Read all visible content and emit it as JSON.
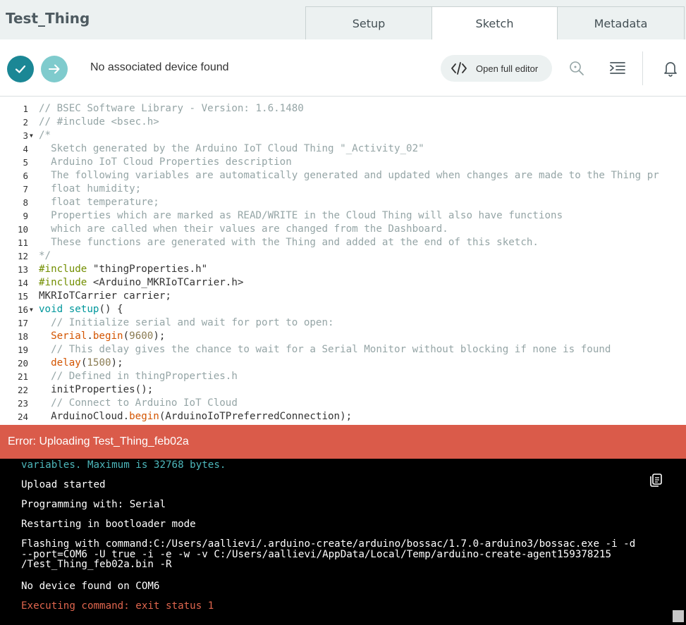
{
  "header": {
    "thing_title": "Test_Thing",
    "tabs": [
      {
        "label": "Setup"
      },
      {
        "label": "Sketch"
      },
      {
        "label": "Metadata"
      }
    ],
    "active_tab": "Sketch"
  },
  "toolbar": {
    "device_status": "No associated device found",
    "open_editor_label": "Open full editor",
    "icons": [
      "check-icon",
      "arrow-right-icon",
      "code-icon",
      "search-icon",
      "indent-icon",
      "bell-icon"
    ]
  },
  "editor": {
    "lines": [
      {
        "n": "1",
        "fold": "",
        "tokens": [
          [
            "c-comment",
            "// BSEC Software Library - Version: 1.6.1480"
          ]
        ]
      },
      {
        "n": "2",
        "fold": "",
        "tokens": [
          [
            "c-comment",
            "// #include <bsec.h>"
          ]
        ]
      },
      {
        "n": "3",
        "fold": "▼",
        "tokens": [
          [
            "c-comment",
            "/*"
          ]
        ]
      },
      {
        "n": "4",
        "fold": "",
        "tokens": [
          [
            "c-comment",
            "  Sketch generated by the Arduino IoT Cloud Thing \"_Activity_02\""
          ]
        ]
      },
      {
        "n": "5",
        "fold": "",
        "tokens": [
          [
            "c-comment",
            "  Arduino IoT Cloud Properties description"
          ]
        ]
      },
      {
        "n": "6",
        "fold": "",
        "tokens": [
          [
            "c-comment",
            "  The following variables are automatically generated and updated when changes are made to the Thing pr"
          ]
        ]
      },
      {
        "n": "7",
        "fold": "",
        "tokens": [
          [
            "c-comment",
            "  float humidity;"
          ]
        ]
      },
      {
        "n": "8",
        "fold": "",
        "tokens": [
          [
            "c-comment",
            "  float temperature;"
          ]
        ]
      },
      {
        "n": "9",
        "fold": "",
        "tokens": [
          [
            "c-comment",
            "  Properties which are marked as READ/WRITE in the Cloud Thing will also have functions"
          ]
        ]
      },
      {
        "n": "10",
        "fold": "",
        "tokens": [
          [
            "c-comment",
            "  which are called when their values are changed from the Dashboard."
          ]
        ]
      },
      {
        "n": "11",
        "fold": "",
        "tokens": [
          [
            "c-comment",
            "  These functions are generated with the Thing and added at the end of this sketch."
          ]
        ]
      },
      {
        "n": "12",
        "fold": "",
        "tokens": [
          [
            "c-comment",
            "*/"
          ]
        ]
      },
      {
        "n": "13",
        "fold": "",
        "tokens": [
          [
            "c-pp",
            "#include"
          ],
          [
            "",
            " \"thingProperties.h\""
          ]
        ]
      },
      {
        "n": "14",
        "fold": "",
        "tokens": [
          [
            "c-pp",
            "#include"
          ],
          [
            "",
            " <Arduino_MKRIoTCarrier.h>"
          ]
        ]
      },
      {
        "n": "15",
        "fold": "",
        "tokens": [
          [
            "",
            "MKRIoTCarrier carrier;"
          ]
        ]
      },
      {
        "n": "16",
        "fold": "▼",
        "tokens": [
          [
            "c-kw",
            "void"
          ],
          [
            "",
            " "
          ],
          [
            "c-kw",
            "setup"
          ],
          [
            "",
            "() {"
          ]
        ]
      },
      {
        "n": "17",
        "fold": "",
        "tokens": [
          [
            "c-comment",
            "  // Initialize serial and wait for port to open:"
          ]
        ]
      },
      {
        "n": "18",
        "fold": "",
        "tokens": [
          [
            "",
            "  "
          ],
          [
            "c-fn",
            "Serial"
          ],
          [
            "",
            "."
          ],
          [
            "c-fn",
            "begin"
          ],
          [
            "",
            "("
          ],
          [
            "c-num",
            "9600"
          ],
          [
            "",
            ");"
          ]
        ]
      },
      {
        "n": "19",
        "fold": "",
        "tokens": [
          [
            "c-comment",
            "  // This delay gives the chance to wait for a Serial Monitor without blocking if none is found"
          ]
        ]
      },
      {
        "n": "20",
        "fold": "",
        "tokens": [
          [
            "",
            "  "
          ],
          [
            "c-fn",
            "delay"
          ],
          [
            "",
            "("
          ],
          [
            "c-num",
            "1500"
          ],
          [
            "",
            ");"
          ]
        ]
      },
      {
        "n": "21",
        "fold": "",
        "tokens": [
          [
            "c-comment",
            "  // Defined in thingProperties.h"
          ]
        ]
      },
      {
        "n": "22",
        "fold": "",
        "tokens": [
          [
            "",
            "  initProperties();"
          ]
        ]
      },
      {
        "n": "23",
        "fold": "",
        "tokens": [
          [
            "c-comment",
            "  // Connect to Arduino IoT Cloud"
          ]
        ]
      },
      {
        "n": "24",
        "fold": "",
        "tokens": [
          [
            "",
            "  ArduinoCloud."
          ],
          [
            "c-fn",
            "begin"
          ],
          [
            "",
            "(ArduinoIoTPreferredConnection);"
          ]
        ]
      }
    ]
  },
  "error_banner": {
    "text": "Error: Uploading Test_Thing_feb02a"
  },
  "console": {
    "lines": [
      {
        "style": "console-green",
        "text": "variables. Maximum is 32768 bytes."
      },
      {
        "style": "",
        "text": "Upload started"
      },
      {
        "style": "",
        "text": "Programming with: Serial"
      },
      {
        "style": "",
        "text": "Restarting in bootloader mode"
      },
      {
        "style": "",
        "text": "Flashing with command:C:/Users/aallievi/.arduino-create/arduino/bossac/1.7.0-arduino3/bossac.exe -i -d\n--port=COM6 -U true -i -e -w -v C:/Users/aallievi/AppData/Local/Temp/arduino-create-agent159378215\n/Test_Thing_feb02a.bin -R"
      },
      {
        "style": "",
        "text": "No device found on COM6"
      },
      {
        "style": "console-red",
        "text": "Executing command: exit status 1"
      }
    ]
  }
}
